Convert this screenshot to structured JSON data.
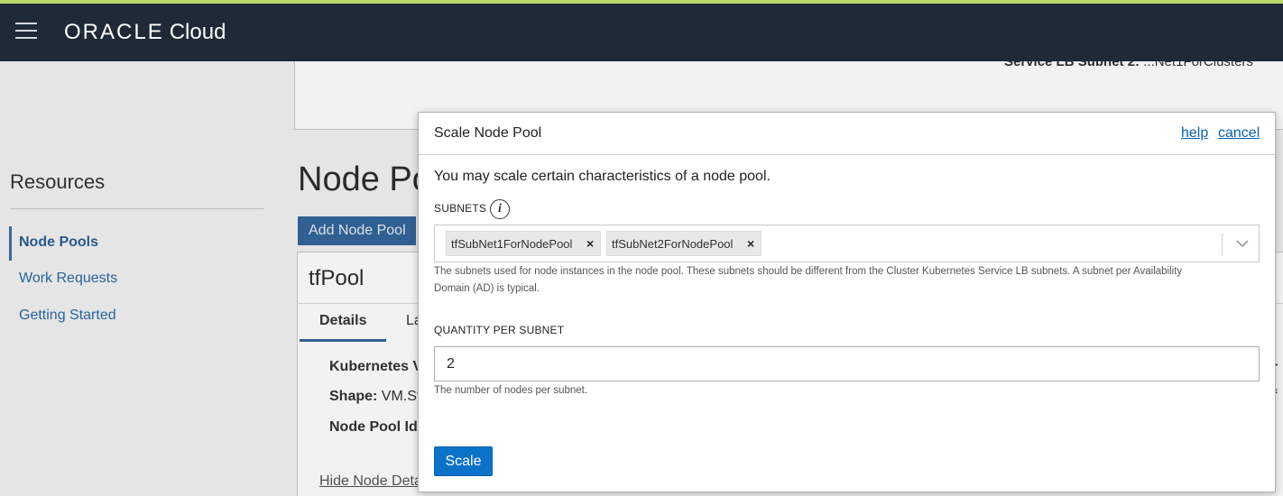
{
  "header": {
    "brand": "ORACLE",
    "brand_suffix": "Cloud"
  },
  "background": {
    "lb_subnet_label": "Service LB Subnet 2:",
    "lb_subnet_value": "...Net1ForClusters",
    "resources": {
      "title": "Resources",
      "items": [
        {
          "label": "Node Pools",
          "active": true
        },
        {
          "label": "Work Requests",
          "active": false
        },
        {
          "label": "Getting Started",
          "active": false
        }
      ]
    },
    "section_title": "Node Po",
    "add_button": "Add Node Pool",
    "pool": {
      "name": "tfPool",
      "tab_details": "Details",
      "tab_other": "La",
      "details": [
        {
          "label": "Kubernetes V",
          "value": ""
        },
        {
          "label": "Shape:",
          "value": " VM.St"
        },
        {
          "label": "Node Pool Id:",
          "value": ""
        }
      ],
      "right_fragments": [
        "r",
        "f"
      ],
      "hide_link": "Hide Node Deta"
    }
  },
  "modal": {
    "title": "Scale Node Pool",
    "help": "help",
    "cancel": "cancel",
    "intro": "You may scale certain characteristics of a node pool.",
    "subnets": {
      "label": "SUBNETS",
      "info_icon": "i",
      "chips": [
        {
          "label": "tfSubNet1ForNodePool",
          "remove": "×"
        },
        {
          "label": "tfSubNet2ForNodePool",
          "remove": "×"
        }
      ],
      "help_line1": "The subnets used for node instances in the node pool. These subnets should be different from the Cluster Kubernetes Service LB subnets. A subnet per Availability",
      "help_line2": "Domain (AD) is typical."
    },
    "quantity": {
      "label": "QUANTITY PER SUBNET",
      "value": "2",
      "help": "The number of nodes per subnet."
    },
    "scale_button": "Scale"
  },
  "colors": {
    "topbar": "#1f2a36",
    "accent_line": "#b8d86b",
    "link": "#0b62b3",
    "primary_button": "#0b72c9"
  },
  "icons": [
    "hamburger-menu-icon",
    "info-icon",
    "chevron-down-icon",
    "remove-chip-icon"
  ]
}
